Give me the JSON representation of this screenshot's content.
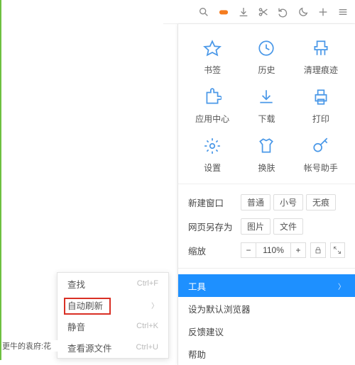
{
  "toolbar": {
    "icons": [
      "search-icon",
      "gamepad-icon",
      "download-icon",
      "scissors-icon",
      "undo-icon",
      "moon-icon",
      "plus-icon",
      "menu-icon"
    ]
  },
  "grid": {
    "items": [
      {
        "label": "书签"
      },
      {
        "label": "历史"
      },
      {
        "label": "清理痕迹"
      },
      {
        "label": "应用中心"
      },
      {
        "label": "下载"
      },
      {
        "label": "打印"
      },
      {
        "label": "设置"
      },
      {
        "label": "换肤"
      },
      {
        "label": "帐号助手"
      }
    ]
  },
  "rows": {
    "new_window": {
      "label": "新建窗口",
      "options": [
        "普通",
        "小号",
        "无痕"
      ]
    },
    "save_as": {
      "label": "网页另存为",
      "options": [
        "图片",
        "文件"
      ]
    },
    "zoom": {
      "label": "缩放",
      "minus": "−",
      "value": "110%",
      "plus": "+"
    }
  },
  "menu": {
    "tools": {
      "label": "工具"
    },
    "default_browser": {
      "label": "设为默认浏览器"
    },
    "feedback": {
      "label": "反馈建议"
    },
    "help": {
      "label": "帮助"
    }
  },
  "submenu": {
    "items": [
      {
        "label": "查找",
        "shortcut": "Ctrl+F"
      },
      {
        "label": "自动刷新"
      },
      {
        "label": "静音",
        "shortcut": "Ctrl+K"
      },
      {
        "label": "查看源文件",
        "shortcut": "Ctrl+U"
      }
    ]
  },
  "partial_text": "更牛的袁府:花"
}
